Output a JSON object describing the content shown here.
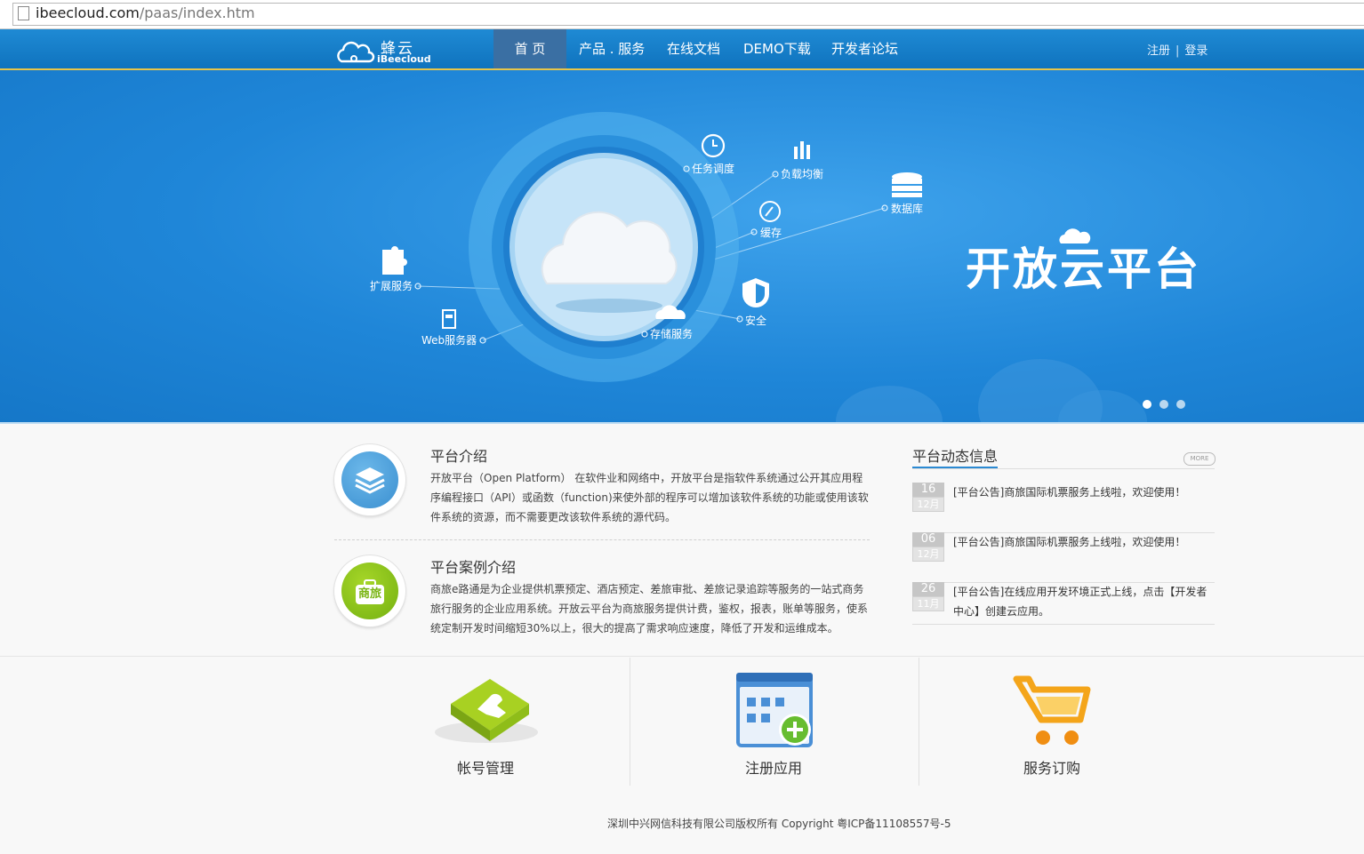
{
  "browser": {
    "url_host": "ibeecloud.com",
    "url_path": "/paas/index.htm"
  },
  "header": {
    "logo_cn": "蜂云",
    "logo_en": "iBeecloud",
    "nav": [
      "首 页",
      "产品 . 服务",
      "在线文档",
      "DEMO下载",
      "开发者论坛"
    ],
    "register": "注册",
    "separator": "|",
    "login": "登录"
  },
  "banner": {
    "title": "开放云平台",
    "labels": {
      "task": "任务调度",
      "balance": "负载均衡",
      "database": "数据库",
      "cache": "缓存",
      "extension": "扩展服务",
      "web": "Web服务器",
      "storage": "存储服务",
      "security": "安全"
    },
    "slides_total": 3,
    "slide_active": 1
  },
  "intro": {
    "platform_title": "平台介绍",
    "platform_text": "开放平台（Open Platform） 在软件业和网络中，开放平台是指软件系统通过公开其应用程序编程接口（API）或函数（function)来使外部的程序可以增加该软件系统的功能或使用该软件系统的资源，而不需要更改该软件系统的源代码。",
    "case_title": "平台案例介绍",
    "case_badge": "商旅",
    "case_text": "商旅e路通是为企业提供机票预定、酒店预定、差旅审批、差旅记录追踪等服务的一站式商务旅行服务的企业应用系统。开放云平台为商旅服务提供计费，鉴权，报表，账单等服务，使系统定制开发时间缩短30%以上，很大的提高了需求响应速度，降低了开发和运维成本。"
  },
  "news": {
    "title": "平台动态信息",
    "more": "MORE",
    "items": [
      {
        "day": "16",
        "month": "12月",
        "text": "[平台公告]商旅国际机票服务上线啦，欢迎使用！"
      },
      {
        "day": "06",
        "month": "12月",
        "text": "[平台公告]商旅国际机票服务上线啦，欢迎使用！"
      },
      {
        "day": "26",
        "month": "11月",
        "text": "[平台公告]在线应用开发环境正式上线，点击【开发者中心】创建云应用。"
      }
    ]
  },
  "quick_links": [
    "帐号管理",
    "注册应用",
    "服务订购"
  ],
  "footer": "深圳中兴网信科技有限公司版权所有 Copyright 粤ICP备11108557号-5",
  "colors": {
    "nav_blue": "#1680cc",
    "accent_gold": "#e7c54a",
    "banner_blue": "#1f86d8"
  }
}
